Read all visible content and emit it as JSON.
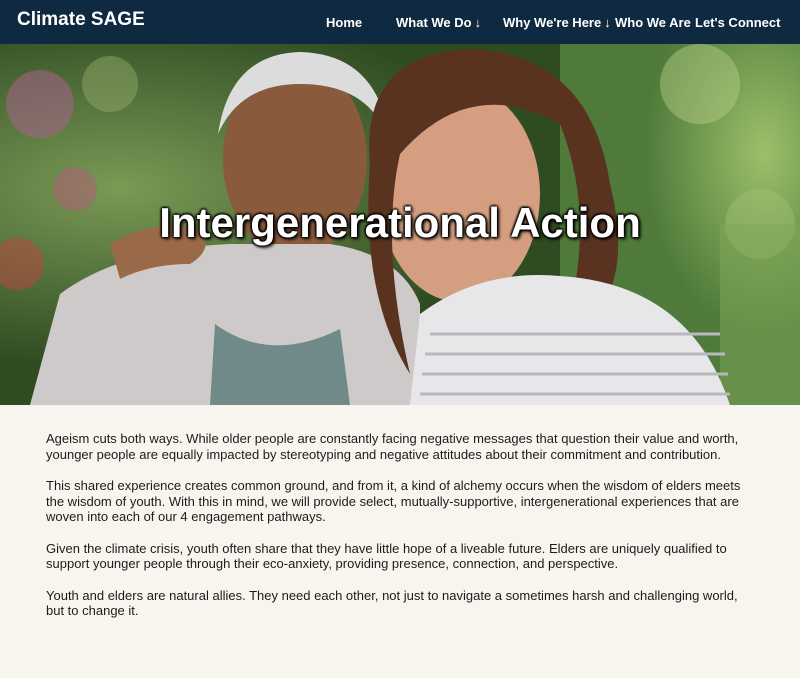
{
  "header": {
    "brand": "Climate SAGE",
    "nav": [
      {
        "label": "Home",
        "dropdown": false
      },
      {
        "label": "What We Do",
        "dropdown": true
      },
      {
        "label": "Why We're Here",
        "dropdown": true
      },
      {
        "label": "Who We Are",
        "dropdown": false
      },
      {
        "label": "Let's Connect",
        "dropdown": false
      }
    ],
    "dropdown_icon": "↓"
  },
  "hero": {
    "title": "Intergenerational Action"
  },
  "content": {
    "paragraphs": [
      "Ageism cuts both ways. While older people are constantly facing negative messages that question their value and worth, younger people are equally impacted by stereotyping and negative attitudes about their commitment and contribution.",
      "This shared experience creates common ground, and from it, a kind of alchemy occurs when the wisdom of elders meets the wisdom of youth. With this in mind, we will provide select, mutually-supportive, intergenerational experiences that are woven into each of our 4 engagement pathways.",
      "Given the climate crisis, youth often share that they have little hope of a liveable future. Elders are uniquely qualified to support younger people through their eco-anxiety, providing presence, connection, and perspective.",
      "Youth and elders are natural allies. They need each other, not just to navigate a sometimes harsh and challenging world, but to change it."
    ]
  },
  "colors": {
    "header_bg": "#0f2a40",
    "page_bg": "#f8f5ef"
  }
}
